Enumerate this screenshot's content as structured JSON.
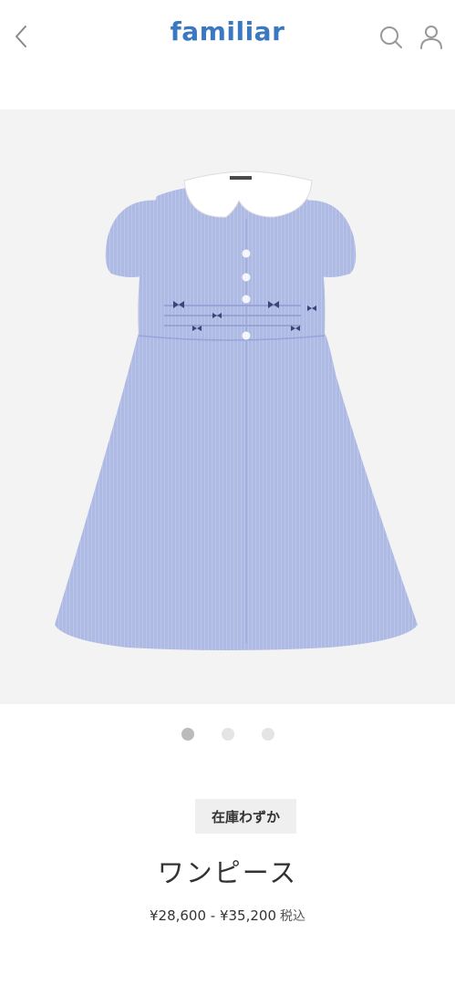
{
  "header": {
    "logo_text": "familiar",
    "back_icon": "chevron-left-icon",
    "search_icon": "search-icon",
    "user_icon": "user-icon"
  },
  "product": {
    "image_alt": "",
    "stock_badge": "在庫わずか",
    "name": "ワンピース",
    "price_range": "¥28,600 - ¥35,200",
    "tax_label": "税込"
  },
  "carousel": {
    "total": 3,
    "active_index": 0
  },
  "colors": {
    "brand_blue": "#3a78c2",
    "icon_gray": "#999999",
    "dot_active": "#bbbbbb",
    "dot_inactive": "#e4e4e4",
    "badge_bg": "#efefef",
    "image_bg": "#f3f3f3",
    "dress_blue": "#aeb9e4"
  }
}
